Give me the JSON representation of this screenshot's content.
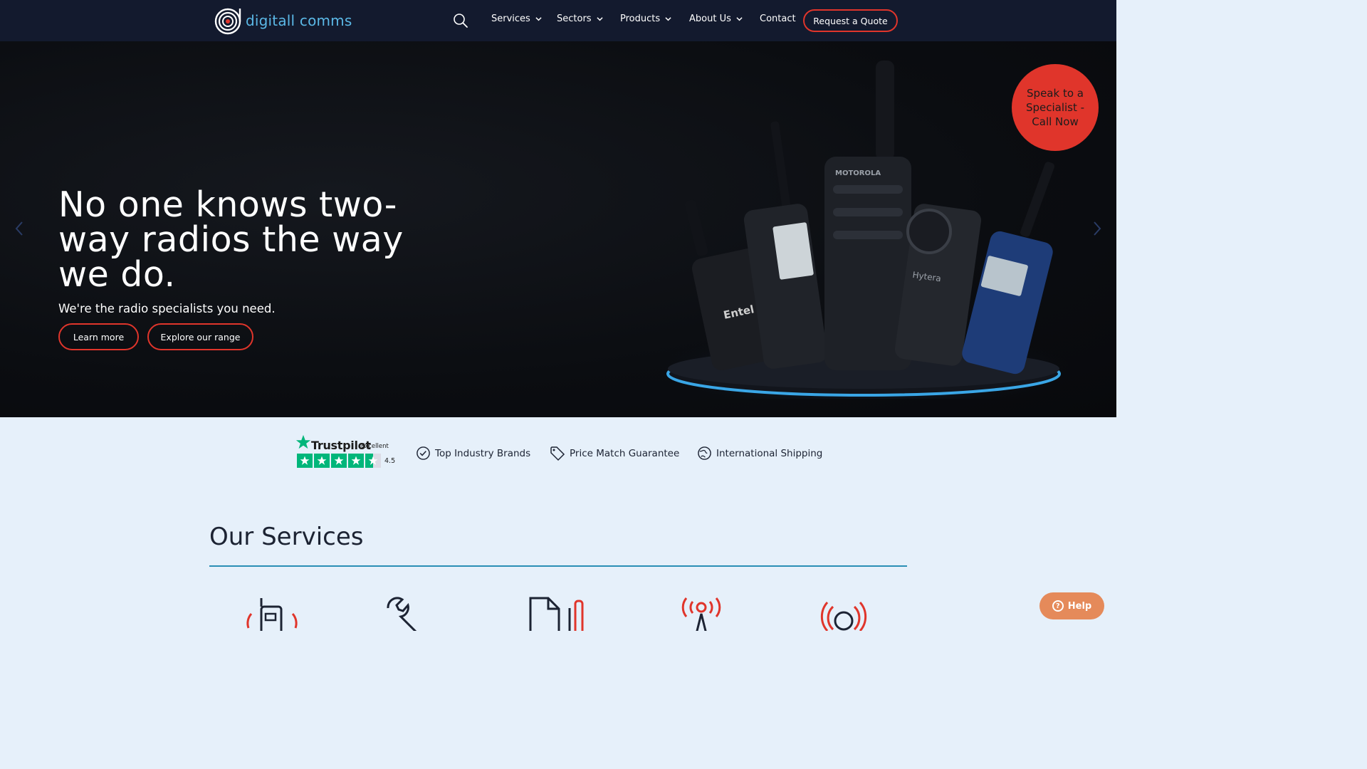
{
  "brand": {
    "name": "digitall comms"
  },
  "nav": {
    "items": [
      {
        "label": "Services"
      },
      {
        "label": "Sectors"
      },
      {
        "label": "Products"
      },
      {
        "label": "About Us"
      },
      {
        "label": "Contact"
      }
    ],
    "quote_label": "Request a Quote"
  },
  "hero": {
    "heading": "No one knows two-way radios the way we do.",
    "subheading": "We're the radio specialists you need.",
    "learn_more": "Learn more",
    "explore": "Explore our range",
    "specialist": "Speak to a Specialist - Call Now",
    "radio_labels": {
      "brand_a": "MOTOROLA",
      "brand_b": "Hytera",
      "brand_c": "Entel"
    }
  },
  "trust": {
    "trustpilot": {
      "name": "Trustpilot",
      "rating_word": "Excellent",
      "score": "4.5",
      "stars": 4.5
    },
    "features": [
      {
        "label": "Top Industry Brands",
        "icon": "check-badge-icon"
      },
      {
        "label": "Price Match Guarantee",
        "icon": "tag-icon"
      },
      {
        "label": "International Shipping",
        "icon": "globe-icon"
      }
    ]
  },
  "services": {
    "title": "Our Services"
  },
  "help": {
    "label": "Help"
  },
  "colors": {
    "nav_bg": "#131a2e",
    "accent": "#e0352b",
    "page_bg": "#e6f0fa",
    "logo_blue": "#5bb8e6",
    "rule": "#2a8fb5"
  }
}
